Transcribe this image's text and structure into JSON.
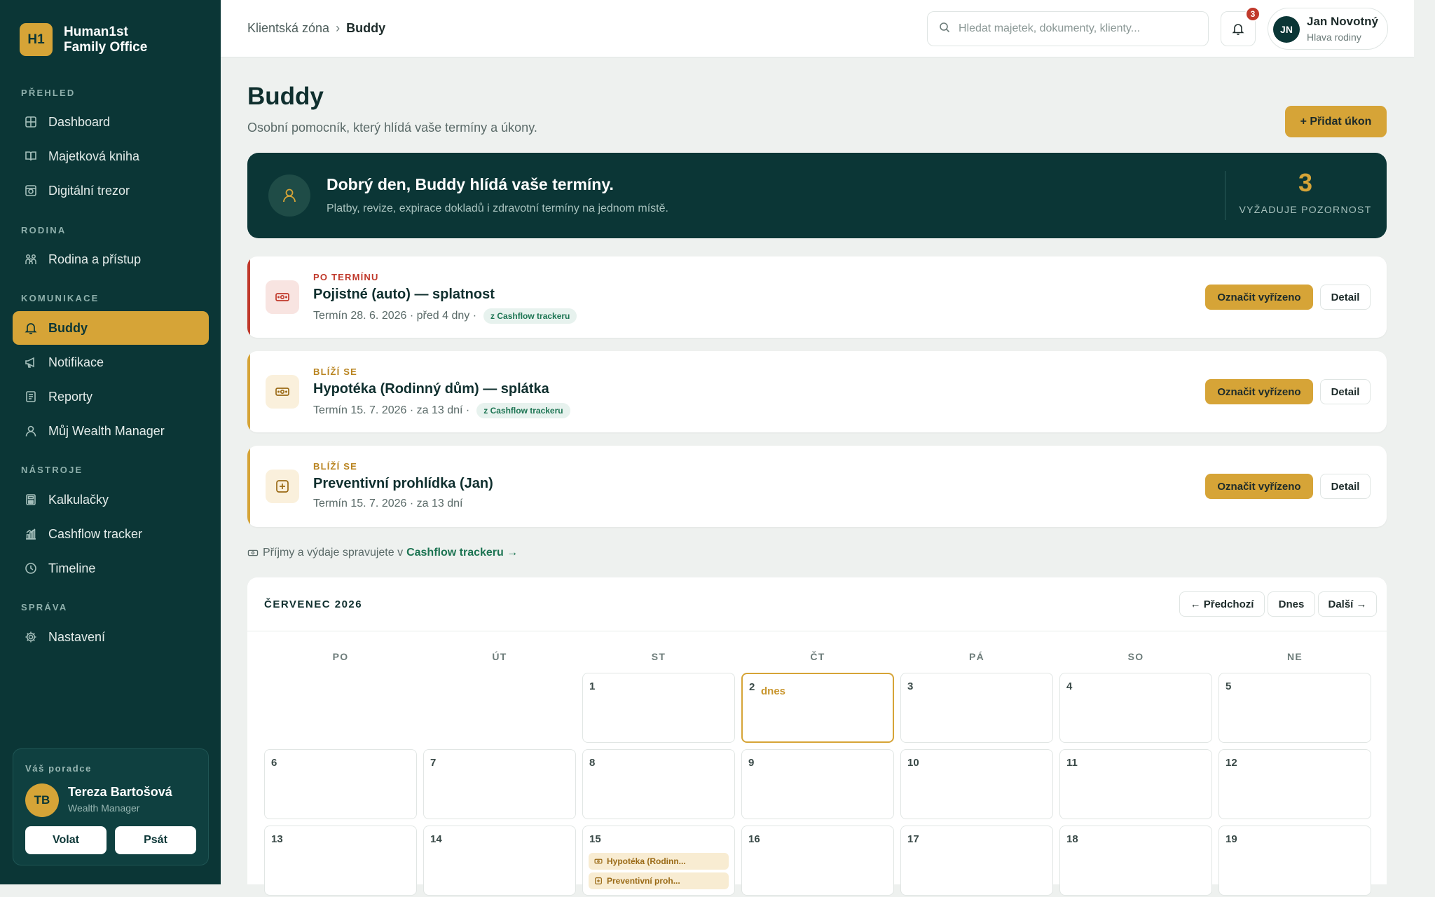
{
  "brand": {
    "badge": "H1",
    "line1": "Human1st",
    "line2": "Family Office"
  },
  "nav": {
    "sections": [
      {
        "label": "PŘEHLED"
      },
      {
        "label": "RODINA"
      },
      {
        "label": "KOMUNIKACE"
      },
      {
        "label": "NÁSTROJE"
      },
      {
        "label": "SPRÁVA"
      }
    ],
    "items": [
      {
        "label": "Dashboard",
        "icon": "grid-icon"
      },
      {
        "label": "Majetková kniha",
        "icon": "book-icon"
      },
      {
        "label": "Digitální trezor",
        "icon": "safe-icon"
      },
      {
        "label": "Rodina a přístup",
        "icon": "family-icon"
      },
      {
        "label": "Buddy",
        "icon": "bell-icon",
        "active": true
      },
      {
        "label": "Notifikace",
        "icon": "megaphone-icon"
      },
      {
        "label": "Reporty",
        "icon": "report-icon"
      },
      {
        "label": "Můj Wealth Manager",
        "icon": "user-icon"
      },
      {
        "label": "Kalkulačky",
        "icon": "calculator-icon"
      },
      {
        "label": "Cashflow tracker",
        "icon": "chart-icon"
      },
      {
        "label": "Timeline",
        "icon": "clock-icon"
      },
      {
        "label": "Nastavení",
        "icon": "gear-icon"
      }
    ]
  },
  "advisor": {
    "title": "Váš poradce",
    "initials": "TB",
    "name": "Tereza Bartošová",
    "role": "Wealth Manager",
    "call_label": "Volat",
    "write_label": "Psát"
  },
  "header": {
    "breadcrumb_root": "Klientská zóna",
    "breadcrumb_sep": "›",
    "breadcrumb_current": "Buddy",
    "search_placeholder": "Hledat majetek, dokumenty, klienty...",
    "notification_count": "3",
    "user_initials": "JN",
    "user_name": "Jan Novotný",
    "user_role": "Hlava rodiny"
  },
  "page": {
    "title": "Buddy",
    "subtitle": "Osobní pomocník, který hlídá vaše termíny a úkony.",
    "add_label": "+ Přidat úkon"
  },
  "hero": {
    "title": "Dobrý den, Buddy hlídá vaše termíny.",
    "subtitle": "Platby, revize, expirace dokladů i zdravotní termíny na jednom místě.",
    "count": "3",
    "count_label": "VYŽADUJE POZORNOST"
  },
  "colors": {
    "accent": "#d6a437",
    "primary": "#0b3636",
    "overdue": "#c0392b",
    "link": "#1c7452"
  },
  "tasks": [
    {
      "status": "PO TERMÍNU",
      "title": "Pojistné (auto) — splatnost",
      "meta": "Termín 28. 6. 2026 · před 4 dny ·",
      "tag": "z Cashflow trackeru",
      "icon": "money-icon",
      "color": "#c0392b",
      "done_label": "Označit vyřízeno",
      "detail_label": "Detail"
    },
    {
      "status": "BLÍŽÍ SE",
      "title": "Hypotéka (Rodinný dům) — splátka",
      "meta": "Termín 15. 7. 2026 · za 13 dní ·",
      "tag": "z Cashflow trackeru",
      "icon": "money-icon",
      "color": "#c8952c",
      "done_label": "Označit vyřízeno",
      "detail_label": "Detail"
    },
    {
      "status": "BLÍŽÍ SE",
      "title": "Preventivní prohlídka (Jan)",
      "meta": "Termín 15. 7. 2026 · za 13 dní",
      "tag": "",
      "icon": "medical-plus-icon",
      "color": "#c8952c",
      "done_label": "Označit vyřízeno",
      "detail_label": "Detail"
    }
  ],
  "cashflow_note": {
    "text": "Příjmy a výdaje spravujete v",
    "link": "Cashflow trackeru →"
  },
  "calendar": {
    "month": "ČERVENEC 2026",
    "prev_label": "← Předchozí",
    "today_label": "Dnes",
    "next_label": "Další →",
    "weekdays": [
      "PO",
      "ÚT",
      "ST",
      "ČT",
      "PÁ",
      "SO",
      "NE"
    ],
    "today_tag": "dnes",
    "weeks": [
      [
        null,
        null,
        "1",
        "2",
        "3",
        "4",
        "5"
      ],
      [
        "6",
        "7",
        "8",
        "9",
        "10",
        "11",
        "12"
      ],
      [
        "13",
        "14",
        "15",
        "16",
        "17",
        "18",
        "19"
      ]
    ],
    "today": "2",
    "events": [
      {
        "day": "15",
        "label": "Hypotéka (Rodinn...",
        "icon": "money-icon"
      },
      {
        "day": "15",
        "label": "Preventivní proh...",
        "icon": "medical-plus-icon"
      }
    ]
  }
}
